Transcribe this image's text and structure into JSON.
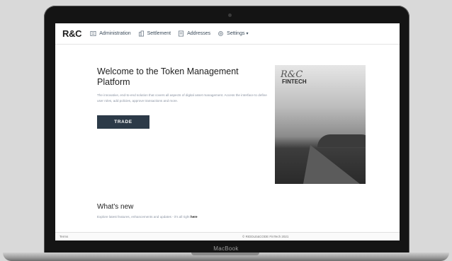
{
  "device": {
    "label": "MacBook"
  },
  "nav": {
    "logo": "R&C",
    "items": [
      {
        "label": "Administration",
        "icon": "id-card-icon"
      },
      {
        "label": "Settlement",
        "icon": "building-icon"
      },
      {
        "label": "Addresses",
        "icon": "address-book-icon"
      },
      {
        "label": "Settings",
        "icon": "gear-icon",
        "dropdown": true
      }
    ]
  },
  "hero": {
    "title": "Welcome to the Token Management Platform",
    "description": "The innovative, end-to-end solution that covers all aspects of digital asset management. Access the interface to define user roles, add policies, approve transactions and more.",
    "cta": "TRADE",
    "image": {
      "signature": "R&C",
      "brand": "FINTECH"
    }
  },
  "news": {
    "title": "What's new",
    "subtitle_prefix": "Explore latest features, enhancements and updates - it's all right",
    "subtitle_link": "here"
  },
  "footer": {
    "left": "Terms",
    "copyright": "© RIDDLE&CODE FinTech 2021"
  },
  "colors": {
    "primary_button": "#2c3a48",
    "nav_text": "#3a4a59",
    "muted_text": "#8a93a2"
  }
}
